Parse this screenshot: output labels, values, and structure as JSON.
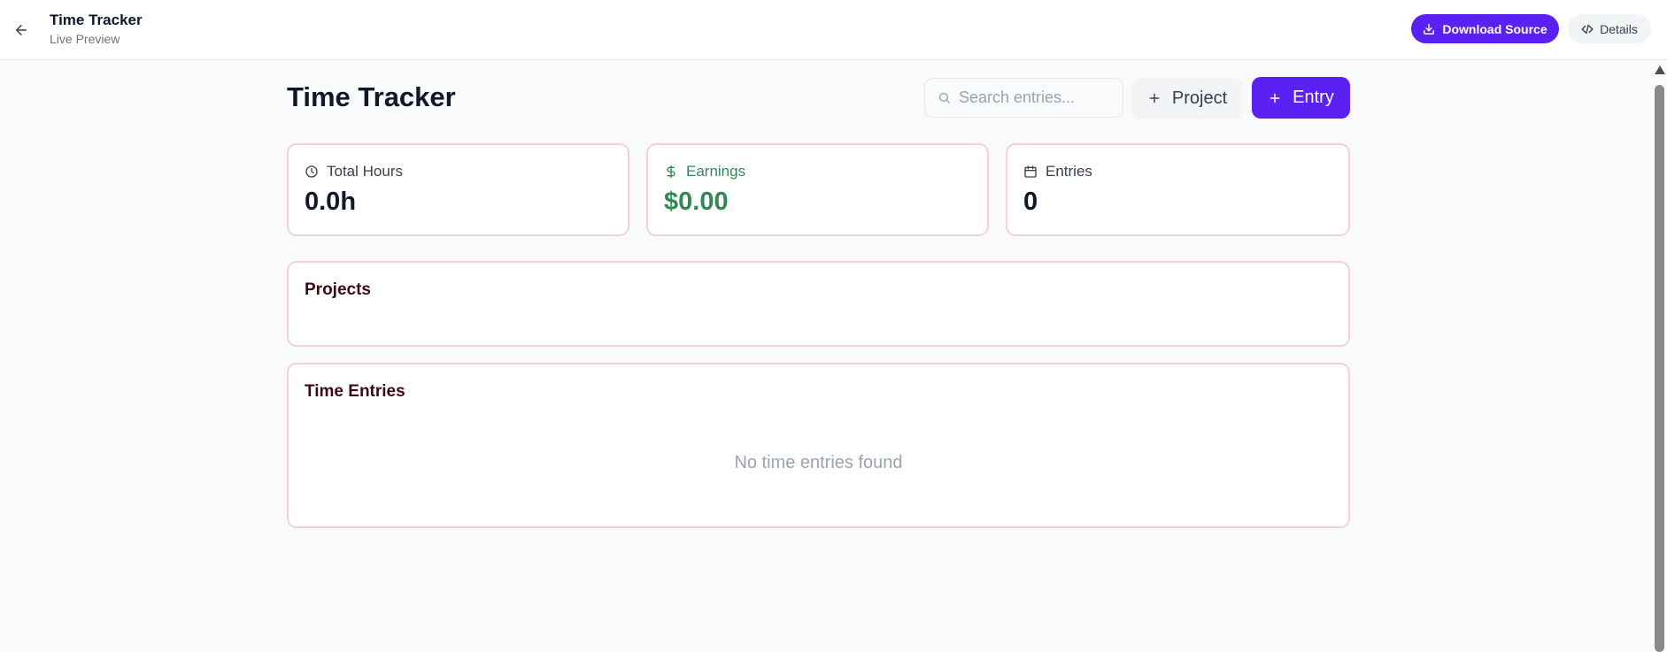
{
  "header": {
    "title": "Time Tracker",
    "subtitle": "Live Preview",
    "download_label": "Download Source",
    "details_label": "Details"
  },
  "page": {
    "title": "Time Tracker",
    "search_placeholder": "Search entries...",
    "add_project_label": "Project",
    "add_entry_label": "Entry"
  },
  "stats": {
    "total_hours": {
      "label": "Total Hours",
      "value": "0.0h",
      "icon": "clock-icon"
    },
    "earnings": {
      "label": "Earnings",
      "value": "$0.00",
      "icon": "dollar-icon"
    },
    "entries": {
      "label": "Entries",
      "value": "0",
      "icon": "calendar-icon"
    }
  },
  "projects": {
    "title": "Projects"
  },
  "time_entries": {
    "title": "Time Entries",
    "empty_message": "No time entries found"
  },
  "colors": {
    "accent": "#5b21f2",
    "earnings_green": "#2f8a53",
    "card_border": "#f5d0d8",
    "section_title": "#3b0a14"
  }
}
